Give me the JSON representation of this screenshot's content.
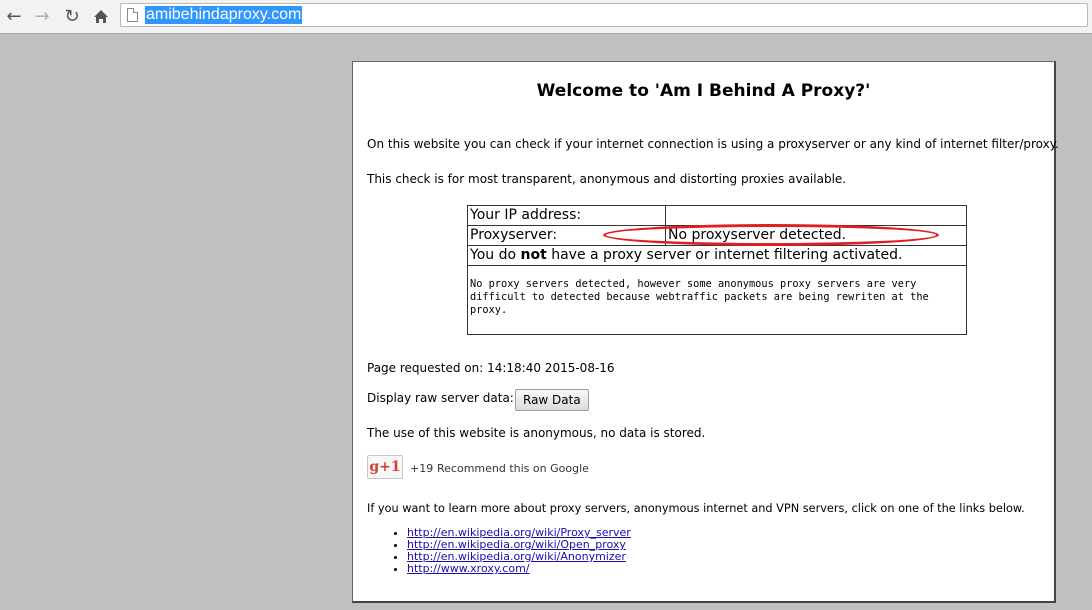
{
  "browser": {
    "url": "amibehindaproxy.com",
    "icons": {
      "back": "back-arrow-icon",
      "forward": "forward-arrow-icon",
      "reload": "reload-icon",
      "home": "home-icon",
      "page": "page-icon"
    }
  },
  "page": {
    "title": "Welcome to 'Am I Behind A Proxy?'",
    "intro1": "On this website you can check if your internet connection is using a proxyserver or any kind of internet filter/proxy.",
    "intro2": "This check is for most transparent, anonymous and distorting proxies available.",
    "table": {
      "ip_label": "Your IP address:",
      "ip_value": "",
      "proxy_label": "Proxyserver:",
      "proxy_value": "No proxyserver detected.",
      "status_pre": "You do ",
      "status_bold": "not",
      "status_post": " have a proxy server or internet filtering activated.",
      "note": "No proxy servers detected, however some anonymous proxy servers are very difficult to detected because webtraffic packets are being rewriten at the proxy."
    },
    "requested_label": "Page requested on: 14:18:40 2015-08-16",
    "raw_label": "Display raw server data:",
    "raw_button": "Raw Data",
    "anonymous_note": "The use of this website is anonymous, no data is stored.",
    "gplus": {
      "button": "g+1",
      "count": "+19",
      "text": "Recommend this on Google"
    },
    "links_intro": "If you want to learn more about proxy servers, anonymous internet and VPN servers, click on one of the links below.",
    "links": [
      "http://en.wikipedia.org/wiki/Proxy_server",
      "http://en.wikipedia.org/wiki/Open_proxy",
      "http://en.wikipedia.org/wiki/Anonymizer",
      "http://www.xroxy.com/"
    ],
    "colors": {
      "highlight_ellipse": "#e02020",
      "link": "#1a0dab",
      "url_selection": "#3297fd"
    }
  }
}
